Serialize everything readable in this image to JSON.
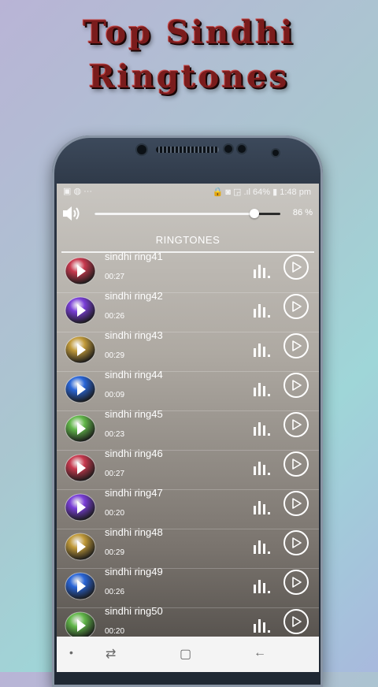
{
  "promo": {
    "line1": "Top Sindhi",
    "line2": "Ringtones"
  },
  "status": {
    "left": "▣ ◍   ···",
    "right": "🔒 ◙ ◲ .ıl 64% ▮ 1:48 pm"
  },
  "volume": {
    "percent_label": "86 %",
    "level": 0.86
  },
  "tab": {
    "label": "RINGTONES"
  },
  "colors": {
    "accent": "#ffffff",
    "screen_bg": "#aea9a2"
  },
  "ringtones": [
    {
      "title": "sindhi ring41",
      "duration": "00:27",
      "ball": "#c8394e",
      "icon": "play-ball-icon"
    },
    {
      "title": "sindhi ring42",
      "duration": "00:26",
      "ball": "#7a3fd8",
      "icon": "play-ball-icon"
    },
    {
      "title": "sindhi ring43",
      "duration": "00:29",
      "ball": "#c29b3a",
      "icon": "play-ball-icon"
    },
    {
      "title": "sindhi ring44",
      "duration": "00:09",
      "ball": "#2a66d8",
      "icon": "play-ball-icon"
    },
    {
      "title": "sindhi ring45",
      "duration": "00:23",
      "ball": "#62b84a",
      "icon": "play-ball-icon"
    },
    {
      "title": "sindhi ring46",
      "duration": "00:27",
      "ball": "#c8394e",
      "icon": "play-ball-icon"
    },
    {
      "title": "sindhi ring47",
      "duration": "00:20",
      "ball": "#7a3fd8",
      "icon": "play-ball-icon"
    },
    {
      "title": "sindhi ring48",
      "duration": "00:29",
      "ball": "#c29b3a",
      "icon": "play-ball-icon"
    },
    {
      "title": "sindhi ring49",
      "duration": "00:26",
      "ball": "#2a66d8",
      "icon": "play-ball-icon"
    },
    {
      "title": "sindhi ring50",
      "duration": "00:20",
      "ball": "#62b84a",
      "icon": "play-ball-icon"
    }
  ],
  "nav": {
    "dot": "•",
    "recent": "⇄",
    "home": "▢",
    "back": "←"
  }
}
